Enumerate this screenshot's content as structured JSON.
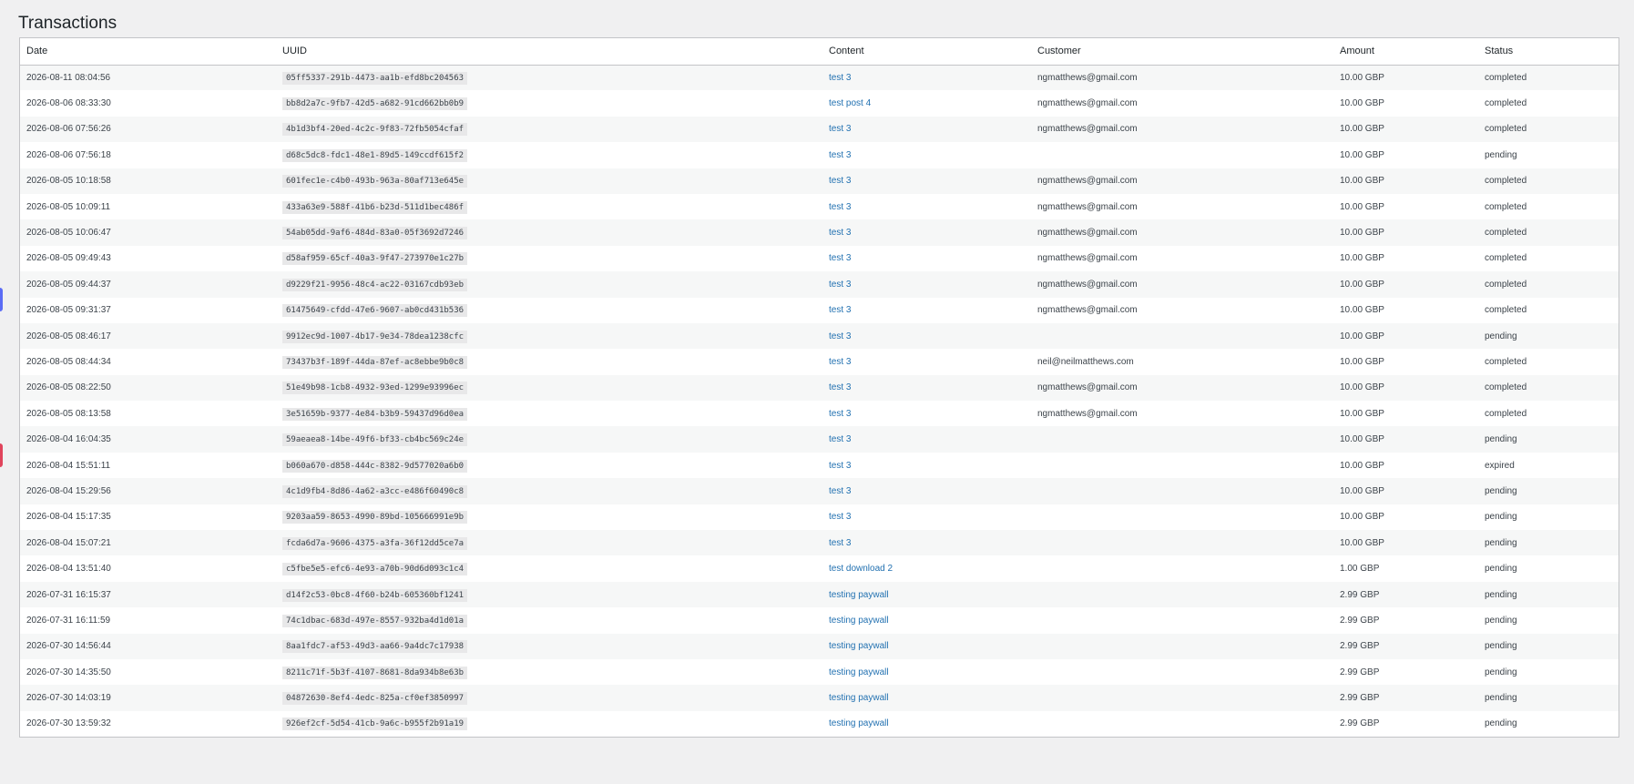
{
  "page": {
    "title": "Transactions"
  },
  "table": {
    "headers": {
      "date": "Date",
      "uuid": "UUID",
      "content": "Content",
      "customer": "Customer",
      "amount": "Amount",
      "status": "Status"
    },
    "rows": [
      {
        "date": "2026-08-11 08:04:56",
        "uuid": "05ff5337-291b-4473-aa1b-efd8bc204563",
        "content": "test 3",
        "customer": "ngmatthews@gmail.com",
        "amount": "10.00 GBP",
        "status": "completed"
      },
      {
        "date": "2026-08-06 08:33:30",
        "uuid": "bb8d2a7c-9fb7-42d5-a682-91cd662bb0b9",
        "content": "test post 4",
        "customer": "ngmatthews@gmail.com",
        "amount": "10.00 GBP",
        "status": "completed"
      },
      {
        "date": "2026-08-06 07:56:26",
        "uuid": "4b1d3bf4-20ed-4c2c-9f83-72fb5054cfaf",
        "content": "test 3",
        "customer": "ngmatthews@gmail.com",
        "amount": "10.00 GBP",
        "status": "completed"
      },
      {
        "date": "2026-08-06 07:56:18",
        "uuid": "d68c5dc8-fdc1-48e1-89d5-149ccdf615f2",
        "content": "test 3",
        "customer": "",
        "amount": "10.00 GBP",
        "status": "pending"
      },
      {
        "date": "2026-08-05 10:18:58",
        "uuid": "601fec1e-c4b0-493b-963a-80af713e645e",
        "content": "test 3",
        "customer": "ngmatthews@gmail.com",
        "amount": "10.00 GBP",
        "status": "completed"
      },
      {
        "date": "2026-08-05 10:09:11",
        "uuid": "433a63e9-588f-41b6-b23d-511d1bec486f",
        "content": "test 3",
        "customer": "ngmatthews@gmail.com",
        "amount": "10.00 GBP",
        "status": "completed"
      },
      {
        "date": "2026-08-05 10:06:47",
        "uuid": "54ab05dd-9af6-484d-83a0-05f3692d7246",
        "content": "test 3",
        "customer": "ngmatthews@gmail.com",
        "amount": "10.00 GBP",
        "status": "completed"
      },
      {
        "date": "2026-08-05 09:49:43",
        "uuid": "d58af959-65cf-40a3-9f47-273970e1c27b",
        "content": "test 3",
        "customer": "ngmatthews@gmail.com",
        "amount": "10.00 GBP",
        "status": "completed"
      },
      {
        "date": "2026-08-05 09:44:37",
        "uuid": "d9229f21-9956-48c4-ac22-03167cdb93eb",
        "content": "test 3",
        "customer": "ngmatthews@gmail.com",
        "amount": "10.00 GBP",
        "status": "completed"
      },
      {
        "date": "2026-08-05 09:31:37",
        "uuid": "61475649-cfdd-47e6-9607-ab0cd431b536",
        "content": "test 3",
        "customer": "ngmatthews@gmail.com",
        "amount": "10.00 GBP",
        "status": "completed"
      },
      {
        "date": "2026-08-05 08:46:17",
        "uuid": "9912ec9d-1007-4b17-9e34-78dea1238cfc",
        "content": "test 3",
        "customer": "",
        "amount": "10.00 GBP",
        "status": "pending"
      },
      {
        "date": "2026-08-05 08:44:34",
        "uuid": "73437b3f-189f-44da-87ef-ac8ebbe9b0c8",
        "content": "test 3",
        "customer": "neil@neilmatthews.com",
        "amount": "10.00 GBP",
        "status": "completed"
      },
      {
        "date": "2026-08-05 08:22:50",
        "uuid": "51e49b98-1cb8-4932-93ed-1299e93996ec",
        "content": "test 3",
        "customer": "ngmatthews@gmail.com",
        "amount": "10.00 GBP",
        "status": "completed"
      },
      {
        "date": "2026-08-05 08:13:58",
        "uuid": "3e51659b-9377-4e84-b3b9-59437d96d0ea",
        "content": "test 3",
        "customer": "ngmatthews@gmail.com",
        "amount": "10.00 GBP",
        "status": "completed"
      },
      {
        "date": "2026-08-04 16:04:35",
        "uuid": "59aeaea8-14be-49f6-bf33-cb4bc569c24e",
        "content": "test 3",
        "customer": "",
        "amount": "10.00 GBP",
        "status": "pending"
      },
      {
        "date": "2026-08-04 15:51:11",
        "uuid": "b060a670-d858-444c-8382-9d577020a6b0",
        "content": "test 3",
        "customer": "",
        "amount": "10.00 GBP",
        "status": "expired"
      },
      {
        "date": "2026-08-04 15:29:56",
        "uuid": "4c1d9fb4-8d86-4a62-a3cc-e486f60490c8",
        "content": "test 3",
        "customer": "",
        "amount": "10.00 GBP",
        "status": "pending"
      },
      {
        "date": "2026-08-04 15:17:35",
        "uuid": "9203aa59-8653-4990-89bd-105666991e9b",
        "content": "test 3",
        "customer": "",
        "amount": "10.00 GBP",
        "status": "pending"
      },
      {
        "date": "2026-08-04 15:07:21",
        "uuid": "fcda6d7a-9606-4375-a3fa-36f12dd5ce7a",
        "content": "test 3",
        "customer": "",
        "amount": "10.00 GBP",
        "status": "pending"
      },
      {
        "date": "2026-08-04 13:51:40",
        "uuid": "c5fbe5e5-efc6-4e93-a70b-90d6d093c1c4",
        "content": "test download 2",
        "customer": "",
        "amount": "1.00 GBP",
        "status": "pending"
      },
      {
        "date": "2026-07-31 16:15:37",
        "uuid": "d14f2c53-0bc8-4f60-b24b-605360bf1241",
        "content": "testing paywall",
        "customer": "",
        "amount": "2.99 GBP",
        "status": "pending"
      },
      {
        "date": "2026-07-31 16:11:59",
        "uuid": "74c1dbac-683d-497e-8557-932ba4d1d01a",
        "content": "testing paywall",
        "customer": "",
        "amount": "2.99 GBP",
        "status": "pending"
      },
      {
        "date": "2026-07-30 14:56:44",
        "uuid": "8aa1fdc7-af53-49d3-aa66-9a4dc7c17938",
        "content": "testing paywall",
        "customer": "",
        "amount": "2.99 GBP",
        "status": "pending"
      },
      {
        "date": "2026-07-30 14:35:50",
        "uuid": "8211c71f-5b3f-4107-8681-8da934b8e63b",
        "content": "testing paywall",
        "customer": "",
        "amount": "2.99 GBP",
        "status": "pending"
      },
      {
        "date": "2026-07-30 14:03:19",
        "uuid": "04872630-8ef4-4edc-825a-cf0ef3850997",
        "content": "testing paywall",
        "customer": "",
        "amount": "2.99 GBP",
        "status": "pending"
      },
      {
        "date": "2026-07-30 13:59:32",
        "uuid": "926ef2cf-5d54-41cb-9a6c-b955f2b91a19",
        "content": "testing paywall",
        "customer": "",
        "amount": "2.99 GBP",
        "status": "pending"
      }
    ]
  },
  "colors": {
    "background": "#f0f0f1",
    "link": "#2271b1",
    "border": "#c3c4c7"
  }
}
